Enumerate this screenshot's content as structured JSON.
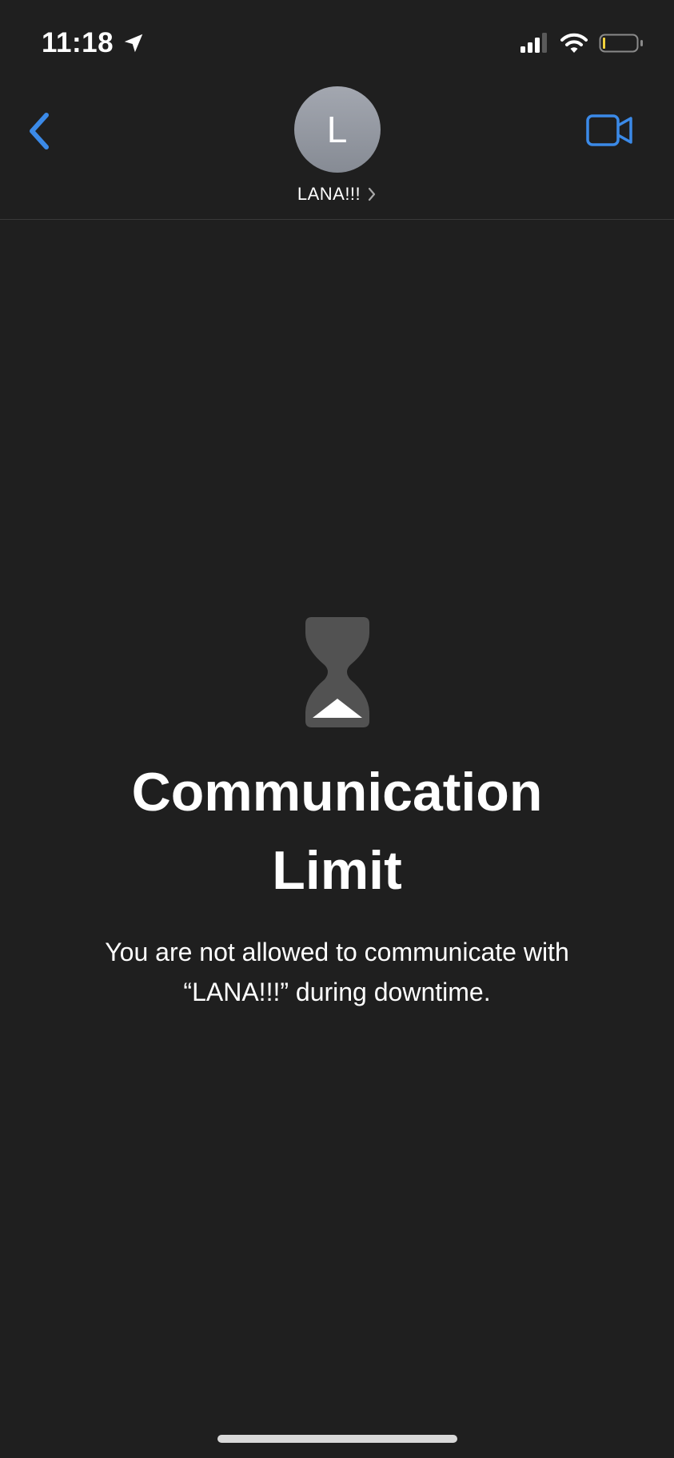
{
  "status_bar": {
    "time": "11:18",
    "icons": [
      "location-arrow-icon",
      "cellular-signal-icon",
      "wifi-icon",
      "battery-low-icon"
    ],
    "battery_color": "#f3d33b"
  },
  "nav": {
    "contact_initial": "L",
    "contact_name": "LANA!!!",
    "accent_color": "#3b8ae8"
  },
  "main": {
    "title": "Communication Limit",
    "message": "You are not allowed to communicate with “LANA!!!” during downtime."
  }
}
